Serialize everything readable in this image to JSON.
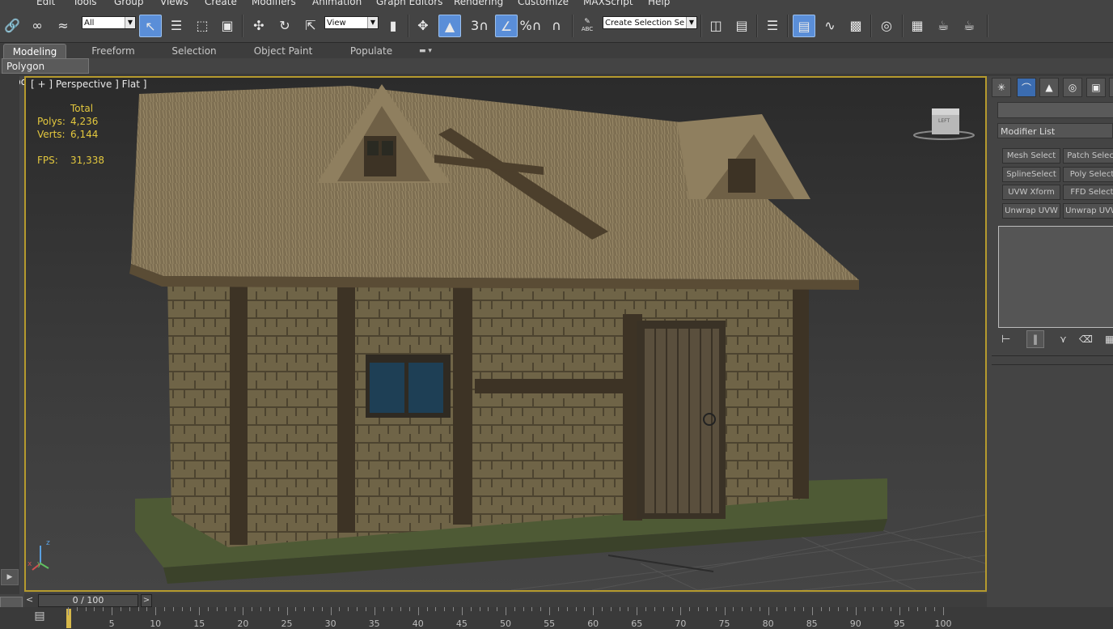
{
  "menu": [
    "Edit",
    "Tools",
    "Group",
    "Views",
    "Create",
    "Modifiers",
    "Animation",
    "Graph Editors",
    "Rendering",
    "Customize",
    "MAXScript",
    "Help"
  ],
  "toolbar": {
    "filter_value": "All",
    "refcoord_value": "View",
    "named_selection_placeholder": "Create Selection Se",
    "snap_label": "3",
    "percent_snap_label": "%",
    "abc_label": "ABC"
  },
  "ribbon": {
    "tabs": [
      "Modeling",
      "Freeform",
      "Selection",
      "Object Paint",
      "Populate"
    ],
    "sub_tab": "Polygon Modeling"
  },
  "viewport": {
    "label": "[ + ] Perspective ] Flat ]",
    "stats_header": "Total",
    "polys_label": "Polys:",
    "polys_value": "4,236",
    "verts_label": "Verts:",
    "verts_value": "6,144",
    "fps_label": "FPS:",
    "fps_value": "31,338",
    "viewcube_label": "LEFT",
    "axis_z": "z",
    "axis_x": "x",
    "axis_y": "y"
  },
  "command_panel": {
    "modifier_list_label": "Modifier List",
    "buttons": [
      [
        "Mesh Select",
        "Patch Select"
      ],
      [
        "SplineSelect",
        "Poly Select"
      ],
      [
        "UVW Xform",
        "FFD Select"
      ],
      [
        "Unwrap UVW",
        "Unwrap UVW"
      ]
    ]
  },
  "timeline": {
    "slider_label": "0 / 100",
    "prev": "<",
    "next": ">",
    "ticks": [
      "5",
      "10",
      "15",
      "20",
      "25",
      "30",
      "35",
      "40",
      "45",
      "50",
      "55",
      "60",
      "65",
      "70",
      "75",
      "80",
      "85",
      "90",
      "95",
      "100"
    ]
  },
  "colors": {
    "viewport_border": "#b59a2e",
    "stat_text": "#e3c83e",
    "active_tool": "#5a8ed8"
  }
}
